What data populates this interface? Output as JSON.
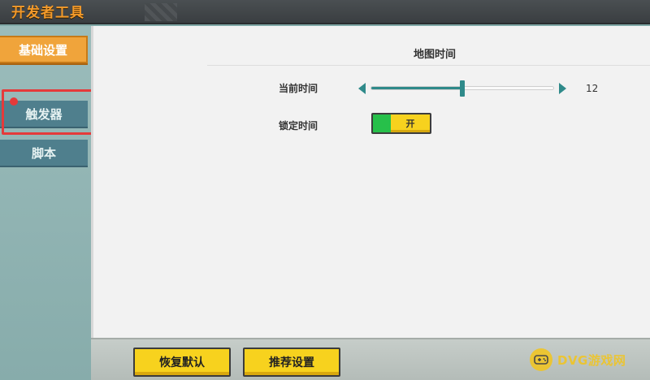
{
  "window": {
    "title": "开发者工具"
  },
  "sidebar": {
    "items": [
      {
        "label": "基础设置",
        "active": true
      },
      {
        "label": "触发器",
        "active": false
      },
      {
        "label": "脚本",
        "active": false
      }
    ]
  },
  "main": {
    "section_title": "地图时间",
    "time_slider": {
      "label": "当前时间",
      "value": "12",
      "min": 0,
      "max": 24
    },
    "lock_toggle": {
      "label": "锁定时间",
      "state_label": "开"
    }
  },
  "footer": {
    "restore_label": "恢复默认",
    "recommend_label": "推荐设置"
  },
  "watermark": {
    "text": "DVG游戏网"
  },
  "colors": {
    "accent": "#f0a43b",
    "teal": "#2f8a8a",
    "button": "#f7d21e",
    "highlight": "#e53a3a"
  },
  "icons": [
    "arrow-left-icon",
    "arrow-right-icon",
    "gamepad-icon"
  ]
}
